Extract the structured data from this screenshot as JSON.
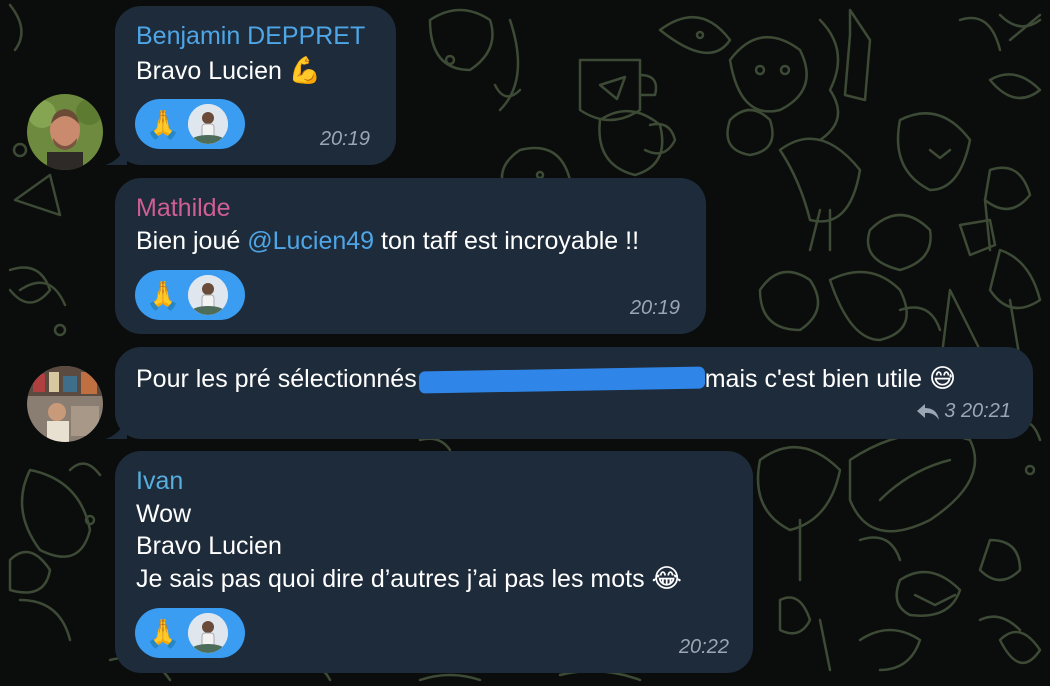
{
  "messages": [
    {
      "sender": "Benjamin DEPPRET",
      "sender_color": "#4ea6e7",
      "text": "Bravo Lucien",
      "text_emoji": "💪",
      "reaction_emoji": "🙏",
      "time": "20:19"
    },
    {
      "sender": "Mathilde",
      "sender_color": "#d05e96",
      "text_before": "Bien joué ",
      "mention": "@Lucien49",
      "text_after": " ton taff est incroyable !!",
      "reaction_emoji": "🙏",
      "time": "20:19"
    },
    {
      "text_before": "Pour les pré sélectionnés",
      "text_after": "mais c'est bien utile",
      "text_emoji": "😅",
      "reply_icon": "reply-arrow-icon",
      "reply_count": "3",
      "time": "20:21"
    },
    {
      "sender": "Ivan",
      "sender_color": "#57aede",
      "lines": [
        "Wow",
        "Bravo Lucien",
        "Je sais pas quoi dire d’autres j’ai pas les mots"
      ],
      "text_emoji": "😂",
      "reaction_emoji": "🙏",
      "time": "20:22"
    }
  ],
  "colors": {
    "bubble": "#1e2b3a",
    "background": "#0b0d0c",
    "reaction": "#3a9df2",
    "redaction": "#2f86e8"
  }
}
